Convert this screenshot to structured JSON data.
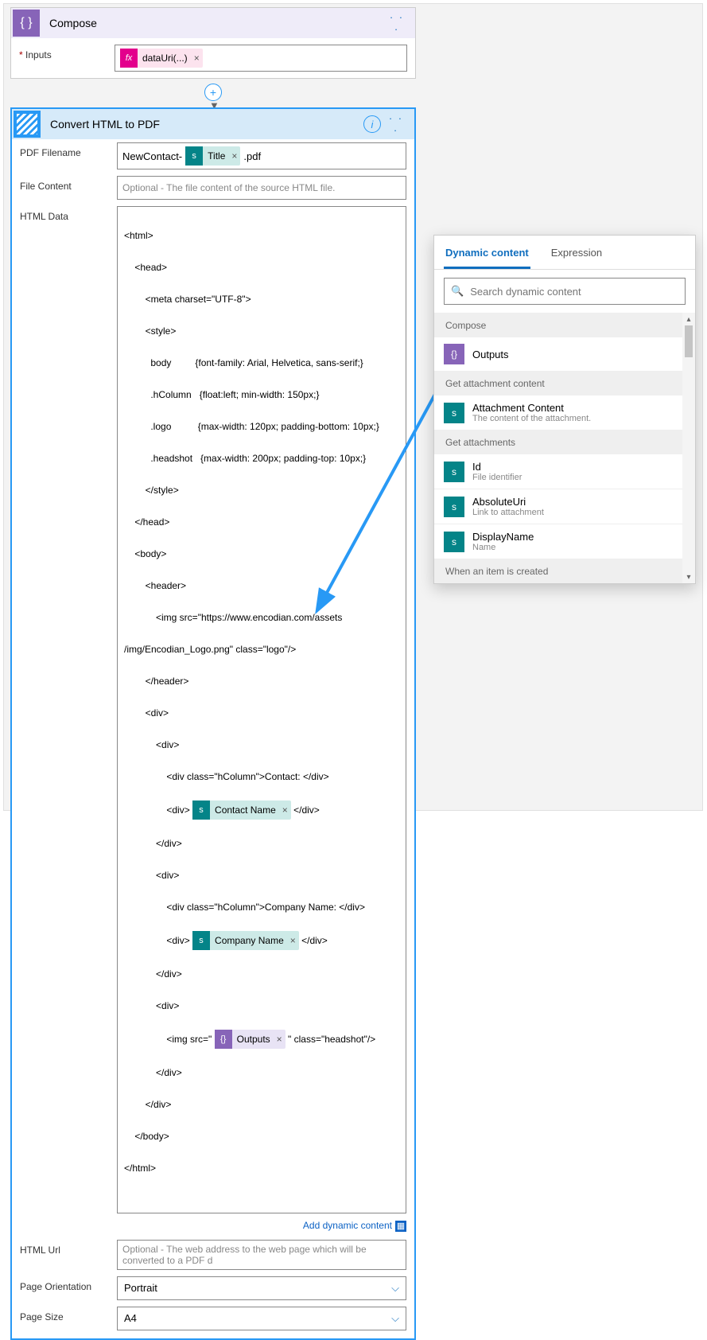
{
  "compose": {
    "title": "Compose",
    "inputs_label": "Inputs",
    "fx_token": "dataUri(...)"
  },
  "encodian": {
    "title": "Convert HTML to PDF",
    "fields": {
      "pdf_filename": "PDF Filename",
      "file_content": "File Content",
      "html_data": "HTML Data",
      "html_url": "HTML Url",
      "page_orientation": "Page Orientation",
      "page_size": "Page Size"
    },
    "pdf_prefix": "NewContact-",
    "pdf_token": "Title",
    "pdf_suffix": ".pdf",
    "file_content_ph": "Optional - The file content of the source HTML file.",
    "html_url_ph": "Optional - The web address to the web page which will be converted to a PDF d",
    "orientation_value": "Portrait",
    "size_value": "A4",
    "add_dyn": "Add dynamic content",
    "code": {
      "l1": "<html>",
      "l2": "    <head>",
      "l3": "        <meta charset=\"UTF-8\">",
      "l4": "        <style>",
      "l5": "          body         {font-family: Arial, Helvetica, sans-serif;}",
      "l6": "          .hColumn   {float:left; min-width: 150px;}",
      "l7": "          .logo          {max-width: 120px; padding-bottom: 10px;}",
      "l8": "          .headshot   {max-width: 200px; padding-top: 10px;}",
      "l9": "        </style>",
      "l10": "    </head>",
      "l11": "    <body>",
      "l12": "        <header>",
      "l13": "            <img src=\"https://www.encodian.com/assets",
      "l14": "/img/Encodian_Logo.png\" class=\"logo\"/>",
      "l15": "        </header>",
      "l16": "        <div>",
      "l17": "            <div>",
      "l18": "                <div class=\"hColumn\">Contact: </div>",
      "l19a": "                <div> ",
      "l19b": " </div>",
      "l20": "            </div>",
      "l21": "            <div>",
      "l22": "                <div class=\"hColumn\">Company Name: </div>",
      "l23a": "                <div> ",
      "l23b": " </div>",
      "l24": "            </div>",
      "l25": "            <div>",
      "l26a": "                <img src=\" ",
      "l26b": " \" class=\"headshot\"/>",
      "l27": "            </div>",
      "l28": "        </div>",
      "l29": "    </body>",
      "l30": "</html>",
      "tok_contact": "Contact Name",
      "tok_company": "Company Name",
      "tok_outputs": "Outputs"
    }
  },
  "dyn": {
    "tab1": "Dynamic content",
    "tab2": "Expression",
    "search_ph": "Search dynamic content",
    "sections": {
      "s1": "Compose",
      "s2": "Get attachment content",
      "s3": "Get attachments",
      "s4": "When an item is created"
    },
    "items": {
      "outputs": {
        "t": "Outputs"
      },
      "att": {
        "t": "Attachment Content",
        "s": "The content of the attachment."
      },
      "id": {
        "t": "Id",
        "s": "File identifier"
      },
      "uri": {
        "t": "AbsoluteUri",
        "s": "Link to attachment"
      },
      "dn": {
        "t": "DisplayName",
        "s": "Name"
      }
    }
  }
}
